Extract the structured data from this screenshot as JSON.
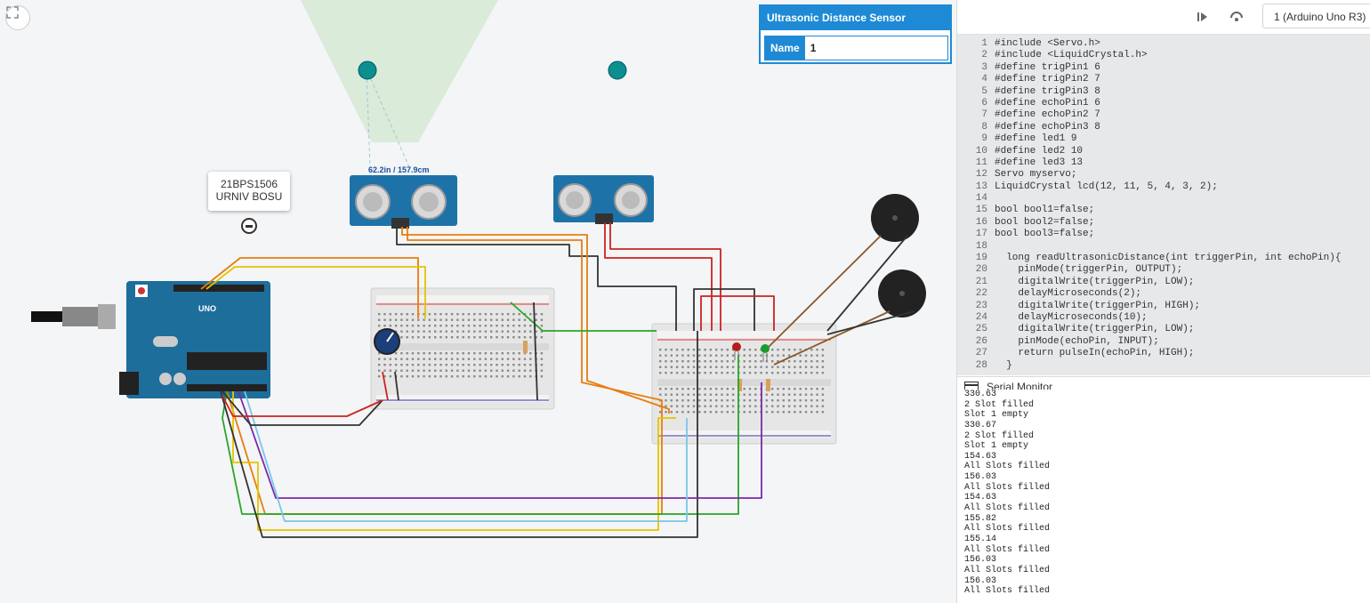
{
  "canvas": {
    "fit_button": "fit-to-view-icon",
    "annotation_label": [
      "21BPS1506",
      "URNIV BOSU"
    ],
    "inspector": {
      "title": "Ultrasonic Distance Sensor",
      "name_label": "Name",
      "name_value": "1"
    },
    "distance_readout": "62.2in / 157.9cm",
    "board_label": "UNO",
    "colors": {
      "sensor": "#1d73a8",
      "arduino": "#1e6e9c",
      "breadboard": "#e8e8e8",
      "inspector": "#1e8ad6",
      "detect_zone": "#d7ead6"
    }
  },
  "toolbar": {
    "step_icon": "step-over-icon",
    "restart_icon": "restart-icon",
    "board_select": "1 (Arduino Uno R3)"
  },
  "code": {
    "line_numbers": [
      "1",
      "2",
      "3",
      "4",
      "5",
      "6",
      "7",
      "8",
      "9",
      "10",
      "11",
      "12",
      "13",
      "14",
      "15",
      "16",
      "17",
      "18",
      "19",
      "20",
      "21",
      "22",
      "23",
      "24",
      "25",
      "26",
      "27",
      "28"
    ],
    "lines": [
      "#include <Servo.h>",
      "#include <LiquidCrystal.h>",
      "#define trigPin1 6",
      "#define trigPin2 7",
      "#define trigPin3 8",
      "#define echoPin1 6",
      "#define echoPin2 7",
      "#define echoPin3 8",
      "#define led1 9",
      "#define led2 10",
      "#define led3 13",
      "Servo myservo;",
      "LiquidCrystal lcd(12, 11, 5, 4, 3, 2);",
      "",
      "bool bool1=false;",
      "bool bool2=false;",
      "bool bool3=false;",
      "",
      "  long readUltrasonicDistance(int triggerPin, int echoPin){",
      "    pinMode(triggerPin, OUTPUT);",
      "    digitalWrite(triggerPin, LOW);",
      "    delayMicroseconds(2);",
      "    digitalWrite(triggerPin, HIGH);",
      "    delayMicroseconds(10);",
      "    digitalWrite(triggerPin, LOW);",
      "    pinMode(echoPin, INPUT);",
      "    return pulseIn(echoPin, HIGH);",
      "  }"
    ]
  },
  "serial_monitor": {
    "title": "Serial Monitor",
    "icon": "serial-monitor-icon",
    "lines": [
      "330.63",
      "2 Slot filled",
      "Slot 1 empty",
      "330.67",
      "2 Slot filled",
      "Slot 1 empty",
      "154.63",
      "All Slots filled",
      "156.03",
      "All Slots filled",
      "154.63",
      "All Slots filled",
      "155.82",
      "All Slots filled",
      "155.14",
      "All Slots filled",
      "156.03",
      "All Slots filled",
      "156.03",
      "All Slots filled"
    ]
  }
}
